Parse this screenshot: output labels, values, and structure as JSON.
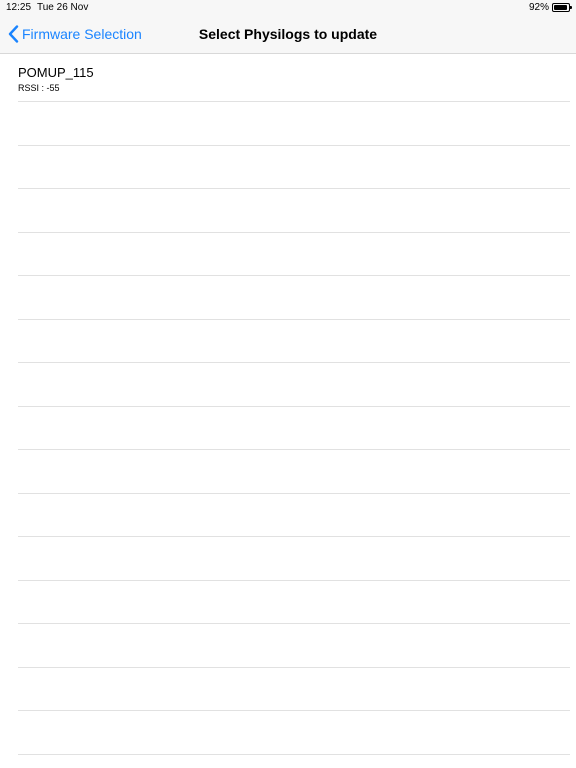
{
  "status_bar": {
    "time": "12:25",
    "date": "Tue 26 Nov",
    "battery_percent": "92%",
    "battery_level": 0.92
  },
  "nav": {
    "back_label": "Firmware Selection",
    "title": "Select Physilogs to update"
  },
  "devices": [
    {
      "name": "POMUP_115",
      "rssi": "RSSI : -55"
    }
  ],
  "colors": {
    "accent": "#1a84ff",
    "separator": "#e1e1e1",
    "bar_background": "#f7f7f7"
  },
  "icons": {
    "back": "chevron-left-icon",
    "battery": "battery-icon"
  }
}
